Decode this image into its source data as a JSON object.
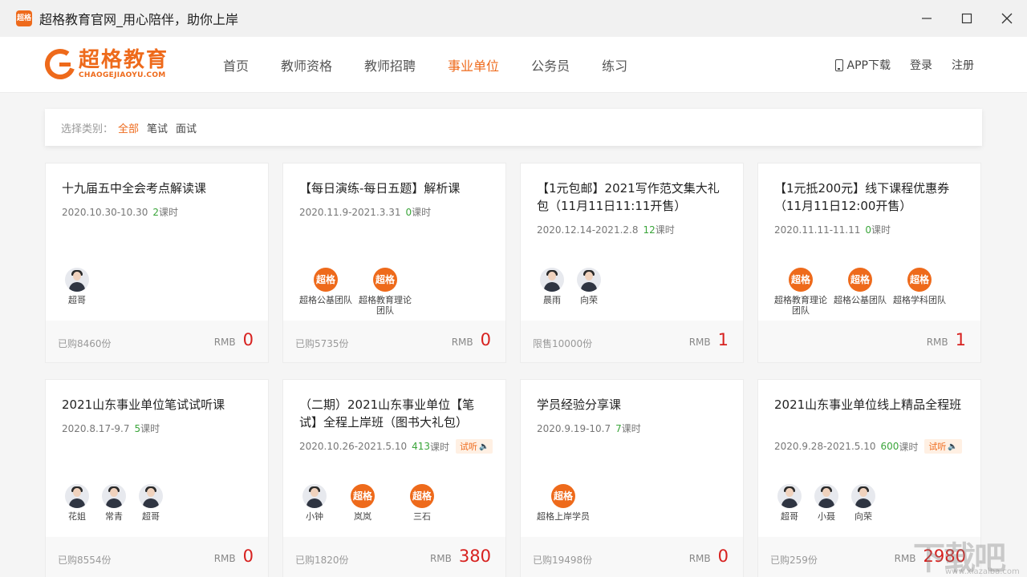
{
  "window": {
    "title": "超格教育官网_用心陪伴，助你上岸",
    "app_icon_text": "超格"
  },
  "header": {
    "logo_cn": "超格教育",
    "logo_en": "CHAOGEJIAOYU.COM",
    "nav": [
      "首页",
      "教师资格",
      "教师招聘",
      "事业单位",
      "公务员",
      "练习"
    ],
    "active_nav": "事业单位",
    "app_download": "APP下载",
    "login": "登录",
    "register": "注册"
  },
  "filter": {
    "label": "选择类别：",
    "options": [
      "全部",
      "笔试",
      "面试"
    ],
    "active": "全部"
  },
  "colors": {
    "accent": "#ee6a1b",
    "price": "#d7211f",
    "lessons": "#3aa53a"
  },
  "courses": [
    {
      "title": "十九届五中全会考点解读课",
      "dates": "2020.10.30-10.30",
      "lessons": "2",
      "lessons_unit": "课时",
      "trial": "",
      "teachers": [
        {
          "name": "超哥",
          "type": "person"
        }
      ],
      "sold": "已购8460份",
      "currency": "RMB",
      "price": "0"
    },
    {
      "title": "【每日演练-每日五题】解析课",
      "dates": "2020.11.9-2021.3.31",
      "lessons": "0",
      "lessons_unit": "课时",
      "trial": "",
      "teachers": [
        {
          "name": "超格公基团队",
          "type": "brand"
        },
        {
          "name": "超格教育理论团队",
          "type": "brand"
        }
      ],
      "sold": "已购5735份",
      "currency": "RMB",
      "price": "0"
    },
    {
      "title": "【1元包邮】2021写作范文集大礼包（11月11日11:11开售）",
      "dates": "2020.12.14-2021.2.8",
      "lessons": "12",
      "lessons_unit": "课时",
      "trial": "",
      "teachers": [
        {
          "name": "晨雨",
          "type": "person"
        },
        {
          "name": "向荣",
          "type": "person"
        }
      ],
      "sold": "限售10000份",
      "currency": "RMB",
      "price": "1"
    },
    {
      "title": "【1元抵200元】线下课程优惠券（11月11日12:00开售）",
      "dates": "2020.11.11-11.11",
      "lessons": "0",
      "lessons_unit": "课时",
      "trial": "",
      "teachers": [
        {
          "name": "超格教育理论团队",
          "type": "brand"
        },
        {
          "name": "超格公基团队",
          "type": "brand"
        },
        {
          "name": "超格学科团队",
          "type": "brand"
        }
      ],
      "sold": "",
      "currency": "RMB",
      "price": "1"
    },
    {
      "title": "2021山东事业单位笔试试听课",
      "dates": "2020.8.17-9.7",
      "lessons": "5",
      "lessons_unit": "课时",
      "trial": "",
      "teachers": [
        {
          "name": "花姐",
          "type": "person"
        },
        {
          "name": "常青",
          "type": "person"
        },
        {
          "name": "超哥",
          "type": "person"
        }
      ],
      "sold": "已购8554份",
      "currency": "RMB",
      "price": "0"
    },
    {
      "title": "（二期）2021山东事业单位【笔试】全程上岸班（图书大礼包）",
      "dates": "2020.10.26-2021.5.10",
      "lessons": "413",
      "lessons_unit": "课时",
      "trial": "试听",
      "teachers": [
        {
          "name": "小钟",
          "type": "person"
        },
        {
          "name": "岚岚",
          "type": "brand"
        },
        {
          "name": "三石",
          "type": "brand"
        }
      ],
      "sold": "已购1820份",
      "currency": "RMB",
      "price": "380"
    },
    {
      "title": "学员经验分享课",
      "dates": "2020.9.19-10.7",
      "lessons": "7",
      "lessons_unit": "课时",
      "trial": "",
      "teachers": [
        {
          "name": "超格上岸学员",
          "type": "brand"
        }
      ],
      "sold": "已购19498份",
      "currency": "RMB",
      "price": "0"
    },
    {
      "title": "2021山东事业单位线上精品全程班",
      "dates": "2020.9.28-2021.5.10",
      "lessons": "600",
      "lessons_unit": "课时",
      "trial": "试听",
      "teachers": [
        {
          "name": "超哥",
          "type": "person"
        },
        {
          "name": "小聂",
          "type": "person"
        },
        {
          "name": "向荣",
          "type": "person"
        }
      ],
      "sold": "已购259份",
      "currency": "RMB",
      "price": "2980"
    }
  ],
  "watermark": {
    "cn": "下载吧",
    "en": "www.xiazaiba.com"
  }
}
